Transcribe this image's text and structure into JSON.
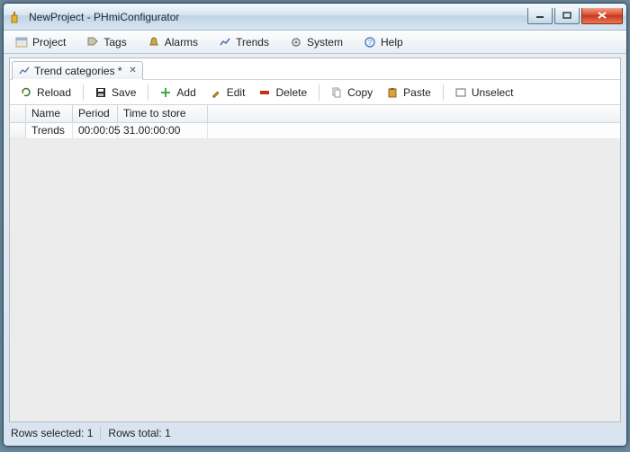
{
  "window": {
    "title": "NewProject - PHmiConfigurator",
    "icon": "app-icon"
  },
  "menu": {
    "project": "Project",
    "tags": "Tags",
    "alarms": "Alarms",
    "trends": "Trends",
    "system": "System",
    "help": "Help"
  },
  "tab": {
    "label": "Trend categories *"
  },
  "toolbar": {
    "reload": "Reload",
    "save": "Save",
    "add": "Add",
    "edit": "Edit",
    "delete": "Delete",
    "copy": "Copy",
    "paste": "Paste",
    "unselect": "Unselect"
  },
  "grid": {
    "headers": {
      "name": "Name",
      "period": "Period",
      "store": "Time to store"
    },
    "rows": [
      {
        "name": "Trends",
        "period": "00:00:05",
        "store": "31.00:00:00"
      }
    ]
  },
  "status": {
    "selected_label": "Rows selected:",
    "selected_count": "1",
    "total_label": "Rows total:",
    "total_count": "1"
  },
  "colors": {
    "accent_close": "#c6331a",
    "plus_green": "#3fae3f",
    "delete_red": "#c62f18"
  }
}
